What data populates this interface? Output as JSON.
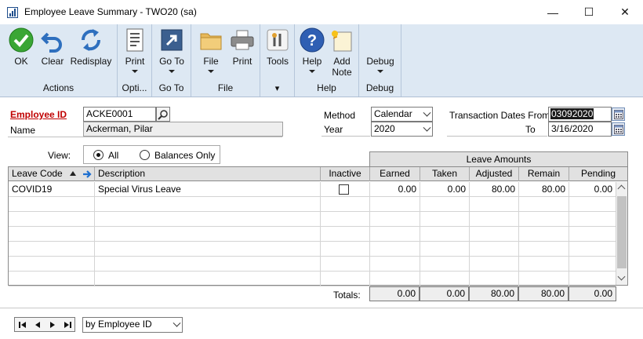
{
  "window": {
    "title": "Employee Leave Summary  -  TWO20 (sa)",
    "minimize_glyph": "—",
    "maximize_glyph": "☐",
    "close_glyph": "✕"
  },
  "ribbon": {
    "groups": {
      "actions": "Actions",
      "options": "Opti...",
      "goto": "Go To",
      "file": "File",
      "tools_glyph": "▾",
      "help": "Help",
      "debug": "Debug"
    },
    "buttons": {
      "ok": "OK",
      "clear": "Clear",
      "redisplay": "Redisplay",
      "print_options": "Print",
      "goto": "Go To",
      "file": "File",
      "print": "Print",
      "tools": "Tools",
      "help": "Help",
      "add_note_1": "Add",
      "add_note_2": "Note",
      "debug": "Debug"
    }
  },
  "form": {
    "employee_id_label": "Employee ID",
    "employee_id_value": "ACKE0001",
    "name_label": "Name",
    "name_value": "Ackerman, Pilar",
    "method_label": "Method",
    "method_value": "Calendar",
    "year_label": "Year",
    "year_value": "2020",
    "trx_from_label": "Transaction Dates From",
    "trx_from_value": "03092020",
    "to_label": "To",
    "to_value": "3/16/2020",
    "view_label": "View:",
    "view_all": "All",
    "view_balances": "Balances Only",
    "view_selected": "all"
  },
  "grid": {
    "group_header": "Leave Amounts",
    "columns": {
      "leave_code": "Leave Code",
      "description": "Description",
      "inactive": "Inactive",
      "earned": "Earned",
      "taken": "Taken",
      "adjusted": "Adjusted",
      "remain": "Remain",
      "pending": "Pending"
    },
    "rows": [
      {
        "leave_code": "COVID19",
        "description": "Special Virus Leave",
        "inactive": false,
        "earned": "0.00",
        "taken": "0.00",
        "adjusted": "80.00",
        "remain": "80.00",
        "pending": "0.00"
      }
    ],
    "totals_label": "Totals:",
    "totals": {
      "earned": "0.00",
      "taken": "0.00",
      "adjusted": "80.00",
      "remain": "80.00",
      "pending": "0.00"
    }
  },
  "footer": {
    "sort_value": "by Employee ID"
  }
}
